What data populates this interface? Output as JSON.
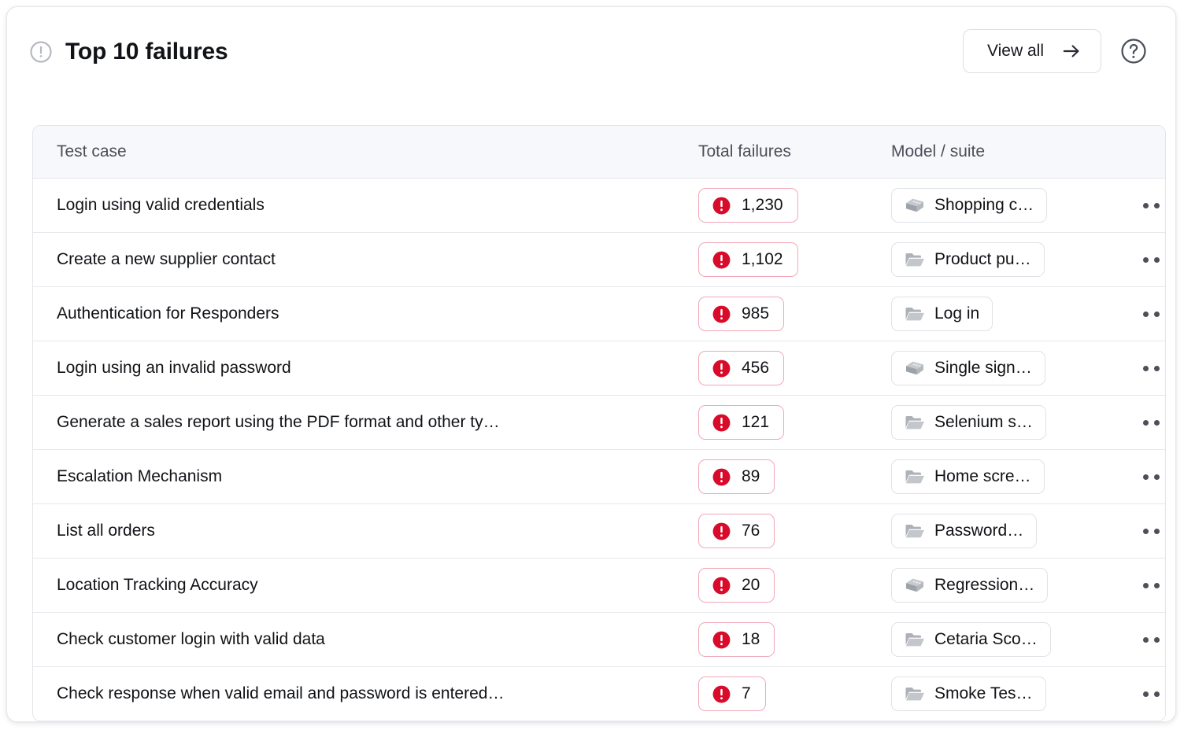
{
  "header": {
    "title": "Top 10 failures",
    "title_icon": "alert-circle-icon",
    "view_all_label": "View all",
    "view_all_icon": "arrow-right-icon",
    "help_icon": "help-circle-icon"
  },
  "table": {
    "columns": {
      "test_case": "Test case",
      "total_failures": "Total failures",
      "model_suite": "Model / suite"
    },
    "row_menu_icon": "ellipsis-horizontal-icon",
    "failure_icon": "exclamation-filled-icon",
    "rows": [
      {
        "test_case": "Login using valid credentials",
        "failures": "1,230",
        "model_suite": "Shopping c…",
        "model_suite_icon": "model-brick-icon"
      },
      {
        "test_case": "Create a new supplier contact",
        "failures": "1,102",
        "model_suite": "Product pu…",
        "model_suite_icon": "folder-open-icon"
      },
      {
        "test_case": "Authentication for Responders",
        "failures": "985",
        "model_suite": "Log in",
        "model_suite_icon": "folder-open-icon"
      },
      {
        "test_case": "Login using an invalid password",
        "failures": "456",
        "model_suite": "Single sign…",
        "model_suite_icon": "model-brick-icon"
      },
      {
        "test_case": "Generate a sales report using the PDF format and other ty…",
        "failures": "121",
        "model_suite": "Selenium s…",
        "model_suite_icon": "folder-open-icon"
      },
      {
        "test_case": "Escalation Mechanism",
        "failures": "89",
        "model_suite": "Home scre…",
        "model_suite_icon": "folder-open-icon"
      },
      {
        "test_case": "List all orders",
        "failures": "76",
        "model_suite": "Password…",
        "model_suite_icon": "folder-open-icon"
      },
      {
        "test_case": "Location Tracking Accuracy",
        "failures": "20",
        "model_suite": "Regression…",
        "model_suite_icon": "model-brick-icon"
      },
      {
        "test_case": "Check customer login with valid data",
        "failures": "18",
        "model_suite": "Cetaria Sco…",
        "model_suite_icon": "folder-open-icon"
      },
      {
        "test_case": "Check response when valid email and password is entered…",
        "failures": "7",
        "model_suite": "Smoke Tes…",
        "model_suite_icon": "folder-open-icon"
      }
    ]
  },
  "colors": {
    "failure_red": "#d80b2b",
    "failure_border": "#f2a8b8",
    "header_bg": "#f7f8fb",
    "text_primary": "#101216",
    "text_secondary": "#4b5059",
    "border": "#e3e5e9"
  }
}
